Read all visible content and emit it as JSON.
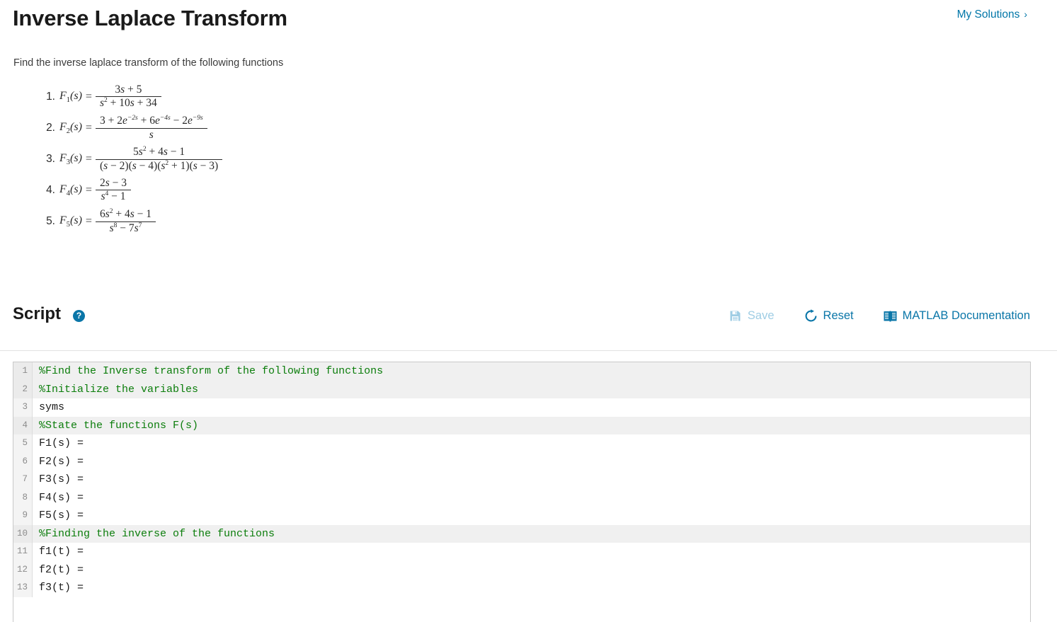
{
  "header": {
    "title": "Inverse Laplace Transform",
    "my_solutions_label": "My Solutions",
    "my_solutions_chevron": "›",
    "link_color": "#0076a8"
  },
  "intro": {
    "text": "Find the inverse laplace transform of the following functions"
  },
  "problems": [
    {
      "number": "1.",
      "lhs": "F",
      "lhs_sub": "1",
      "lhs_arg": "(s)",
      "equals": "=",
      "numerator": "3s + 5",
      "denominator": "s² + 10s + 34",
      "plain": "F1(s) = (3s + 5) / (s^2 + 10s + 34)"
    },
    {
      "number": "2.",
      "lhs": "F",
      "lhs_sub": "2",
      "lhs_arg": "(s)",
      "equals": "=",
      "numerator": "3 + 2e⁻²ˢ + 6e⁻⁴ˢ − 2e⁻⁹ˢ",
      "denominator": "s",
      "plain": "F2(s) = (3 + 2e^-2s + 6e^-4s - 2e^-9s) / s"
    },
    {
      "number": "3.",
      "lhs": "F",
      "lhs_sub": "3",
      "lhs_arg": "(s)",
      "equals": "=",
      "numerator": "5s² + 4s − 1",
      "denominator": "(s − 2)(s − 4)(s² + 1)(s − 3)",
      "plain": "F3(s) = (5s^2 + 4s - 1) / ((s-2)(s-4)(s^2+1)(s-3))"
    },
    {
      "number": "4.",
      "lhs": "F",
      "lhs_sub": "4",
      "lhs_arg": "(s)",
      "equals": "=",
      "numerator": "2s − 3",
      "denominator": "s⁴ − 1",
      "plain": "F4(s) = (2s - 3) / (s^4 - 1)"
    },
    {
      "number": "5.",
      "lhs": "F",
      "lhs_sub": "5",
      "lhs_arg": "(s)",
      "equals": "=",
      "numerator": "6s² + 4s − 1",
      "denominator": "s⁸ − 7s⁷",
      "plain": "F5(s) = (6s^2 + 4s - 1) / (s^8 - 7s^7)"
    }
  ],
  "script": {
    "heading": "Script",
    "help_icon_name": "help-icon",
    "help_glyph": "?",
    "toolbar": {
      "save_label": "Save",
      "save_icon": "floppy-disk-icon",
      "save_disabled": true,
      "save_color": "#9fcde4",
      "reset_label": "Reset",
      "reset_icon": "refresh-circular-arrow-icon",
      "reset_color": "#0a76a8",
      "docs_label": "MATLAB Documentation",
      "docs_icon": "open-book-icon",
      "docs_color": "#0a76a8"
    }
  },
  "editor": {
    "comment_color": "#0b7d0b",
    "code_color": "#1a1a1a",
    "lines": [
      {
        "n": "1",
        "text": "%Find the Inverse transform of the following functions",
        "comment": true
      },
      {
        "n": "2",
        "text": "%Initialize the variables",
        "comment": true
      },
      {
        "n": "3",
        "text": "syms ",
        "comment": false
      },
      {
        "n": "4",
        "text": "%State the functions F(s)",
        "comment": true
      },
      {
        "n": "5",
        "text": "F1(s) = ",
        "comment": false
      },
      {
        "n": "6",
        "text": "F2(s) = ",
        "comment": false
      },
      {
        "n": "7",
        "text": "F3(s) = ",
        "comment": false
      },
      {
        "n": "8",
        "text": "F4(s) = ",
        "comment": false
      },
      {
        "n": "9",
        "text": "F5(s) = ",
        "comment": false
      },
      {
        "n": "10",
        "text": "%Finding the inverse of the functions",
        "comment": true
      },
      {
        "n": "11",
        "text": "f1(t) = ",
        "comment": false
      },
      {
        "n": "12",
        "text": "f2(t) = ",
        "comment": false
      },
      {
        "n": "13",
        "text": "f3(t) = ",
        "comment": false
      }
    ]
  }
}
